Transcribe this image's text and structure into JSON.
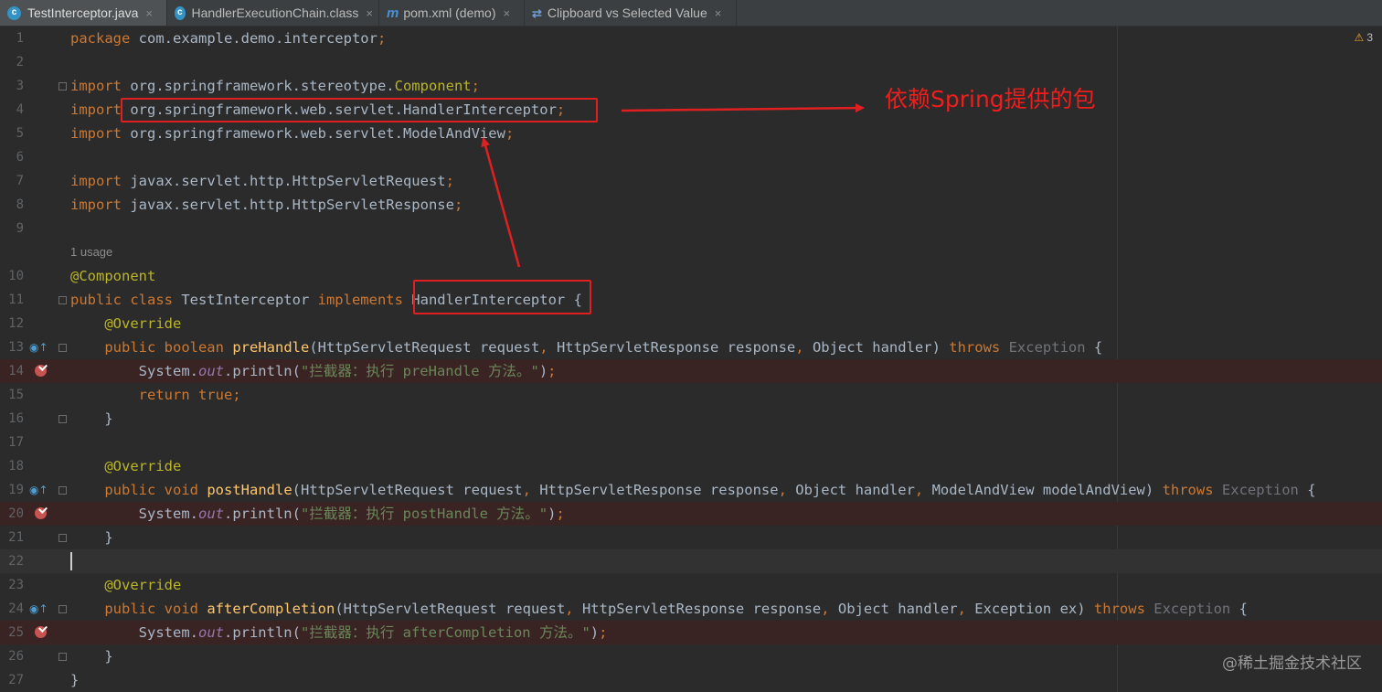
{
  "tabs": [
    {
      "label": "TestInterceptor.java",
      "icon": "java-class-icon",
      "glyph": "c",
      "active": true
    },
    {
      "label": "HandlerExecutionChain.class",
      "icon": "java-class-icon",
      "glyph": "c",
      "active": false
    },
    {
      "label": "pom.xml (demo)",
      "icon": "maven-icon",
      "glyph": "m",
      "active": false
    },
    {
      "label": "Clipboard vs Selected Value",
      "icon": "compare-icon",
      "glyph": "⇄",
      "active": false
    }
  ],
  "tab_close": "×",
  "warnings": {
    "icon": "warning-icon",
    "count": "3"
  },
  "usage_hint": "1 usage",
  "code_lines": [
    {
      "n": "1",
      "html": "<span class=\"kw\">package</span> com.example.demo.interceptor<span class=\"kw\">;</span>"
    },
    {
      "n": "2",
      "html": ""
    },
    {
      "n": "3",
      "html": "<span class=\"kw\">import</span> org.springframework.stereotype.<span class=\"ann\">Component</span><span class=\"kw\">;</span>"
    },
    {
      "n": "4",
      "html": "<span class=\"kw\">import</span> org.springframework.web.servlet.HandlerInterceptor<span class=\"kw\">;</span>"
    },
    {
      "n": "5",
      "html": "<span class=\"kw\">import</span> org.springframework.web.servlet.ModelAndView<span class=\"kw\">;</span>"
    },
    {
      "n": "6",
      "html": ""
    },
    {
      "n": "7",
      "html": "<span class=\"kw\">import</span> javax.servlet.http.HttpServletRequest<span class=\"kw\">;</span>"
    },
    {
      "n": "8",
      "html": "<span class=\"kw\">import</span> javax.servlet.http.HttpServletResponse<span class=\"kw\">;</span>"
    },
    {
      "n": "9",
      "html": ""
    },
    {
      "n": "10",
      "html": "<span class=\"ann\">@Component</span>"
    },
    {
      "n": "11",
      "html": "<span class=\"kw\">public class</span> TestInterceptor <span class=\"kw\">implements</span> HandlerInterceptor {"
    },
    {
      "n": "12",
      "html": "    <span class=\"ann\">@Override</span>"
    },
    {
      "n": "13",
      "html": "    <span class=\"kw\">public boolean</span> <span class=\"fn\">preHandle</span>(HttpServletRequest request<span class=\"kw\">,</span> HttpServletResponse response<span class=\"kw\">,</span> Object handler) <span class=\"kw\">throws</span> <span class=\"dim\">Exception</span> {"
    },
    {
      "n": "14",
      "html": "        System.<span class=\"it\">out</span>.println(<span class=\"str\">\"拦截器：执行 preHandle 方法。\"</span>)<span class=\"kw\">;</span>"
    },
    {
      "n": "15",
      "html": "        <span class=\"kw\">return true;</span>"
    },
    {
      "n": "16",
      "html": "    }"
    },
    {
      "n": "17",
      "html": ""
    },
    {
      "n": "18",
      "html": "    <span class=\"ann\">@Override</span>"
    },
    {
      "n": "19",
      "html": "    <span class=\"kw\">public void</span> <span class=\"fn\">postHandle</span>(HttpServletRequest request<span class=\"kw\">,</span> HttpServletResponse response<span class=\"kw\">,</span> Object handler<span class=\"kw\">,</span> ModelAndView modelAndView) <span class=\"kw\">throws</span> <span class=\"dim\">Exception</span> {"
    },
    {
      "n": "20",
      "html": "        System.<span class=\"it\">out</span>.println(<span class=\"str\">\"拦截器：执行 postHandle 方法。\"</span>)<span class=\"kw\">;</span>"
    },
    {
      "n": "21",
      "html": "    }"
    },
    {
      "n": "22",
      "html": ""
    },
    {
      "n": "23",
      "html": "    <span class=\"ann\">@Override</span>"
    },
    {
      "n": "24",
      "html": "    <span class=\"kw\">public void</span> <span class=\"fn\">afterCompletion</span>(HttpServletRequest request<span class=\"kw\">,</span> HttpServletResponse response<span class=\"kw\">,</span> Object handler<span class=\"kw\">,</span> Exception ex) <span class=\"kw\">throws</span> <span class=\"dim\">Exception</span> {"
    },
    {
      "n": "25",
      "html": "        System.<span class=\"it\">out</span>.println(<span class=\"str\">\"拦截器：执行 afterCompletion 方法。\"</span>)<span class=\"kw\">;</span>"
    },
    {
      "n": "26",
      "html": "    }"
    },
    {
      "n": "27",
      "html": "}"
    }
  ],
  "breakpoint_lines": [
    "14",
    "20",
    "25"
  ],
  "override_lines": [
    "13",
    "19",
    "24"
  ],
  "current_line": "22",
  "annotation_text": "依赖Spring提供的包",
  "watermark": "@稀土掘金技术社区",
  "colors": {
    "annotation_red": "#e02020",
    "background": "#2b2b2b"
  }
}
